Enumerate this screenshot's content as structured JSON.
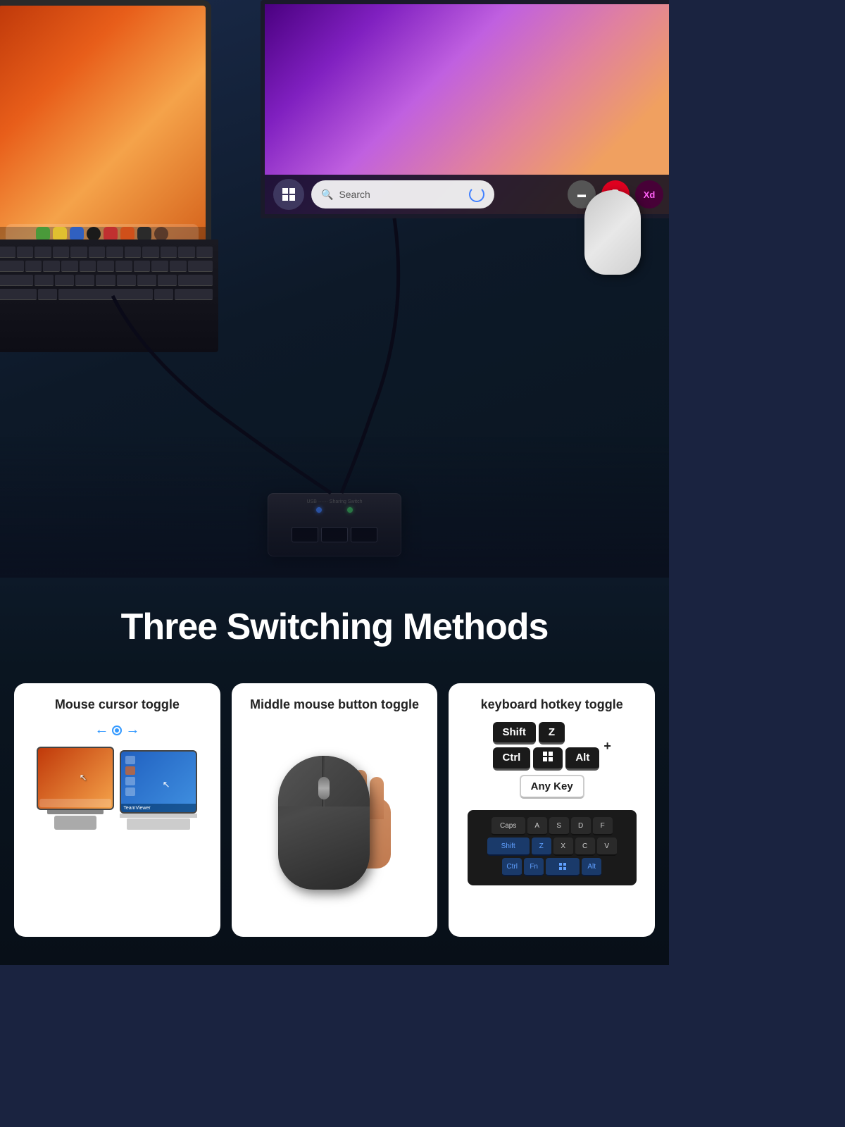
{
  "hero": {
    "alt": "KVM switch setup with laptop and monitor"
  },
  "title": {
    "main": "Three Switching Methods"
  },
  "taskbar": {
    "search_placeholder": "Search",
    "win_icon": "⊞"
  },
  "cards": [
    {
      "id": "mouse-cursor",
      "title": "Mouse cursor toggle",
      "arrow_left": "←",
      "arrow_dot": "●",
      "arrow_right": "→"
    },
    {
      "id": "middle-mouse",
      "title": "Middle mouse button toggle"
    },
    {
      "id": "keyboard-hotkey",
      "title": "keyboard hotkey toggle",
      "keys": [
        "Shift",
        "Z",
        "Ctrl",
        "⊞",
        "Alt"
      ],
      "plus": "+",
      "any_key": "Any Key"
    }
  ],
  "keyboard_keys": {
    "row1": [
      "Caps",
      "A",
      "S",
      "D",
      "F"
    ],
    "row2": [
      "Shift",
      "Z",
      "X",
      "C",
      "V"
    ],
    "row3": [
      "Ctrl",
      "Fn",
      "⊞",
      "Alt"
    ]
  }
}
